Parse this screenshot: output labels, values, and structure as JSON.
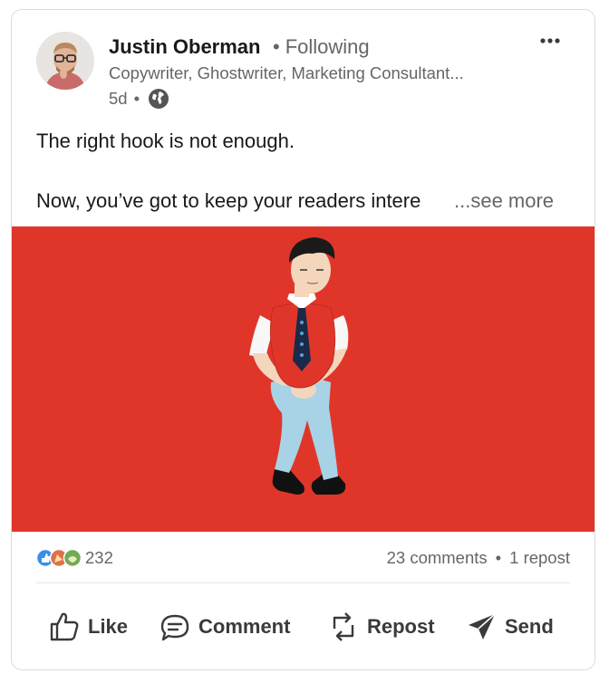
{
  "author": {
    "name": "Justin Oberman",
    "follow_status": "Following",
    "headline": "Copywriter, Ghostwriter, Marketing Consultant...",
    "time_ago": "5d",
    "visibility_icon": "globe-icon"
  },
  "menu": {
    "icon": "more-icon"
  },
  "post": {
    "line1": "The right hook is not enough.",
    "line2": "Now, you’ve got to keep your readers intere",
    "see_more": "...see more",
    "image_bg": "#e0362a"
  },
  "social": {
    "reaction_icons": [
      "like-reaction-icon",
      "celebrate-reaction-icon",
      "support-reaction-icon"
    ],
    "reaction_count": "232",
    "comments": "23 comments",
    "reposts": "1 repost"
  },
  "actions": {
    "like": "Like",
    "comment": "Comment",
    "repost": "Repost",
    "send": "Send"
  },
  "colors": {
    "text_primary": "#191919",
    "text_secondary": "#666666",
    "image_background": "#e0362a"
  }
}
